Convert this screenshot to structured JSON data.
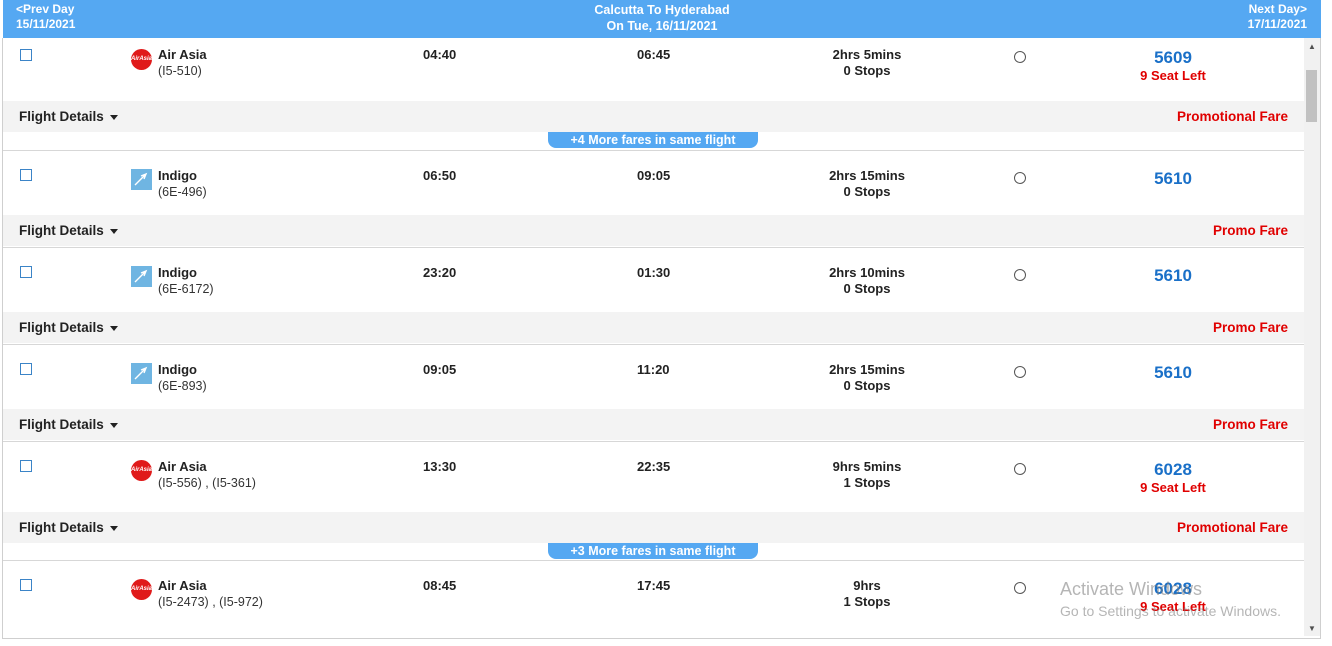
{
  "header": {
    "prev_label": "<Prev Day",
    "prev_date": "15/11/2021",
    "route": "Calcutta To Hyderabad",
    "date_line": "On Tue, 16/11/2021",
    "next_label": "Next Day>",
    "next_date": "17/11/2021"
  },
  "details_label": "Flight Details",
  "flights": [
    {
      "airline": "Air Asia",
      "code": "(I5-510)",
      "logo": "airasia-logo",
      "dep": "04:40",
      "arr": "06:45",
      "duration": "2hrs 5mins",
      "stops": "0 Stops",
      "price": "5609",
      "seats": "9 Seat Left",
      "fare": "Promotional Fare",
      "more": "+4 More fares in same flight"
    },
    {
      "airline": "Indigo",
      "code": "(6E-496)",
      "logo": "indigo-logo",
      "dep": "06:50",
      "arr": "09:05",
      "duration": "2hrs 15mins",
      "stops": "0 Stops",
      "price": "5610",
      "seats": "",
      "fare": "Promo Fare",
      "more": ""
    },
    {
      "airline": "Indigo",
      "code": "(6E-6172)",
      "logo": "indigo-logo",
      "dep": "23:20",
      "arr": "01:30",
      "duration": "2hrs 10mins",
      "stops": "0 Stops",
      "price": "5610",
      "seats": "",
      "fare": "Promo Fare",
      "more": ""
    },
    {
      "airline": "Indigo",
      "code": "(6E-893)",
      "logo": "indigo-logo",
      "dep": "09:05",
      "arr": "11:20",
      "duration": "2hrs 15mins",
      "stops": "0 Stops",
      "price": "5610",
      "seats": "",
      "fare": "Promo Fare",
      "more": ""
    },
    {
      "airline": "Air Asia",
      "code": "(I5-556) , (I5-361)",
      "logo": "airasia-logo",
      "dep": "13:30",
      "arr": "22:35",
      "duration": "9hrs 5mins",
      "stops": "1 Stops",
      "price": "6028",
      "seats": "9 Seat Left",
      "fare": "Promotional Fare",
      "more": "+3 More fares in same flight"
    },
    {
      "airline": "Air Asia",
      "code": "(I5-2473) , (I5-972)",
      "logo": "airasia-logo",
      "dep": "08:45",
      "arr": "17:45",
      "duration": "9hrs",
      "stops": "1 Stops",
      "price": "6028",
      "seats": "9 Seat Left",
      "fare": "",
      "more": ""
    }
  ],
  "airasia_logo_text": "AirAsia",
  "watermark": {
    "title": "Activate Windows",
    "sub": "Go to Settings to activate Windows."
  },
  "colors": {
    "header": "#55a8f2",
    "price": "#1a70c8",
    "alert": "#e00000"
  }
}
